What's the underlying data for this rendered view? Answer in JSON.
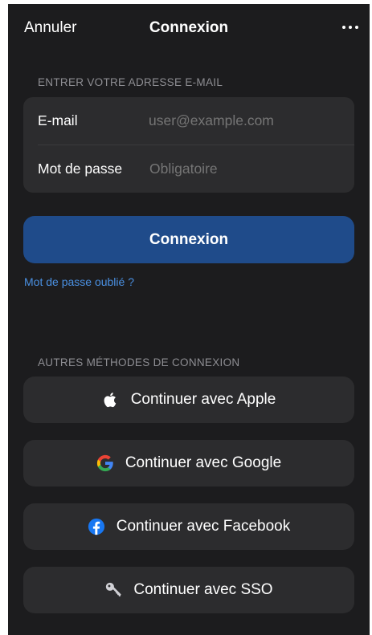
{
  "header": {
    "cancel_label": "Annuler",
    "title": "Connexion",
    "more_icon": "ellipsis-icon"
  },
  "email_section": {
    "label": "ENTRER VOTRE ADRESSE E-MAIL",
    "email_label": "E-mail",
    "email_placeholder": "user@example.com",
    "password_label": "Mot de passe",
    "password_placeholder": "Obligatoire"
  },
  "login_button": {
    "label": "Connexion"
  },
  "forgot_password": {
    "label": "Mot de passe oublié ?"
  },
  "other_methods": {
    "label": "AUTRES MÉTHODES DE CONNEXION",
    "buttons": [
      {
        "label": "Continuer avec Apple",
        "icon": "apple-icon"
      },
      {
        "label": "Continuer avec Google",
        "icon": "google-icon"
      },
      {
        "label": "Continuer avec Facebook",
        "icon": "facebook-icon"
      },
      {
        "label": "Continuer avec SSO",
        "icon": "key-icon"
      }
    ]
  },
  "colors": {
    "background": "#1c1c1e",
    "card": "#2c2c2e",
    "primary": "#1f4b8a",
    "link": "#4a90e2",
    "muted_text": "#8e8e93"
  }
}
